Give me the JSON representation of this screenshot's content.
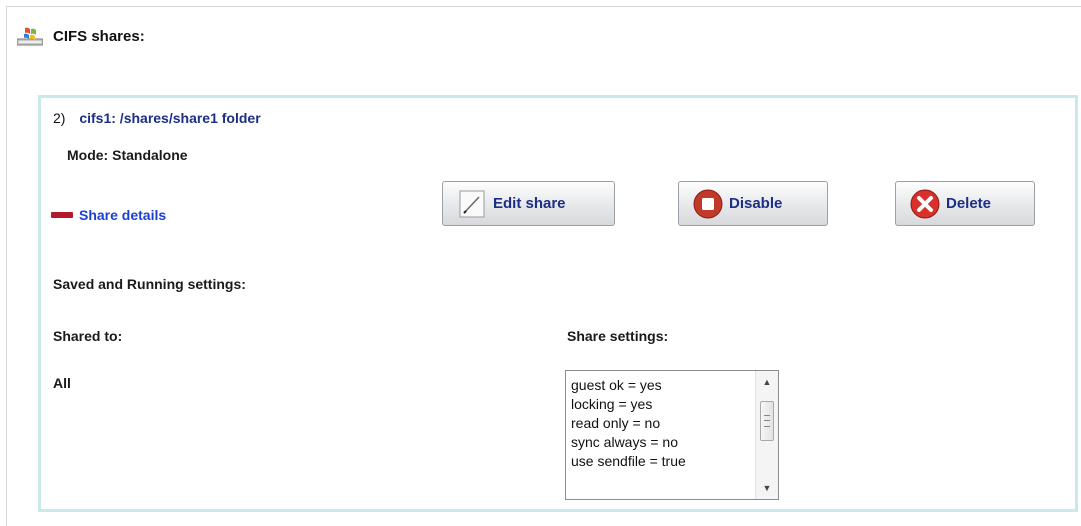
{
  "header": {
    "title": "CIFS shares:",
    "icon": "windows-drive-icon"
  },
  "share": {
    "number": "2)",
    "path": "cifs1: /shares/share1 folder",
    "mode": "Mode: Standalone",
    "details_link": "Share details",
    "buttons": {
      "edit": "Edit share",
      "disable": "Disable",
      "delete": "Delete"
    },
    "saved_running_label": "Saved and Running settings:",
    "shared_to_label": "Shared to:",
    "shared_to_value": "All",
    "share_settings_label": "Share settings:",
    "settings": [
      "guest ok = yes",
      "locking = yes",
      "read only = no",
      "sync always = no",
      "use sendfile = true"
    ]
  },
  "colors": {
    "link": "#1c3fd8",
    "title_blue": "#1b2f86",
    "box_border": "#cbe8ea",
    "disable_red": "#c0392b",
    "delete_red": "#d8302a",
    "collapse_red": "#b3182d"
  }
}
